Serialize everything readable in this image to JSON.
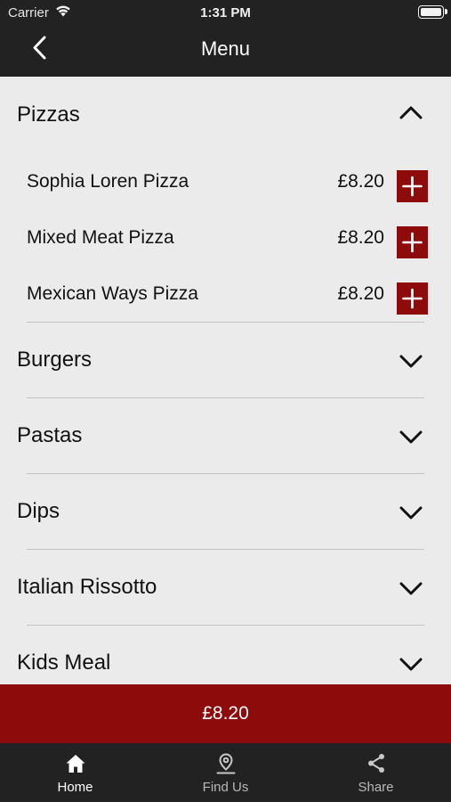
{
  "status_bar": {
    "carrier": "Carrier",
    "time": "1:31 PM"
  },
  "nav": {
    "title": "Menu",
    "back_icon": "chevron-left-icon"
  },
  "categories": [
    {
      "name": "Pizzas",
      "expanded": true,
      "items": [
        {
          "name": "Sophia Loren Pizza",
          "price": "£8.20"
        },
        {
          "name": "Mixed Meat Pizza",
          "price": "£8.20"
        },
        {
          "name": "Mexican Ways Pizza",
          "price": "£8.20"
        }
      ]
    },
    {
      "name": "Burgers",
      "expanded": false
    },
    {
      "name": "Pastas",
      "expanded": false
    },
    {
      "name": "Dips",
      "expanded": false
    },
    {
      "name": "Italian Rissotto",
      "expanded": false
    },
    {
      "name": "Kids Meal",
      "expanded": false
    }
  ],
  "cart": {
    "total": "£8.20"
  },
  "tabs": [
    {
      "label": "Home",
      "icon": "home-icon",
      "active": true
    },
    {
      "label": "Find Us",
      "icon": "location-pin-icon",
      "active": false
    },
    {
      "label": "Share",
      "icon": "share-icon",
      "active": false
    }
  ],
  "colors": {
    "accent": "#8e0b0b",
    "bar": "#222222",
    "background": "#ebebeb"
  }
}
